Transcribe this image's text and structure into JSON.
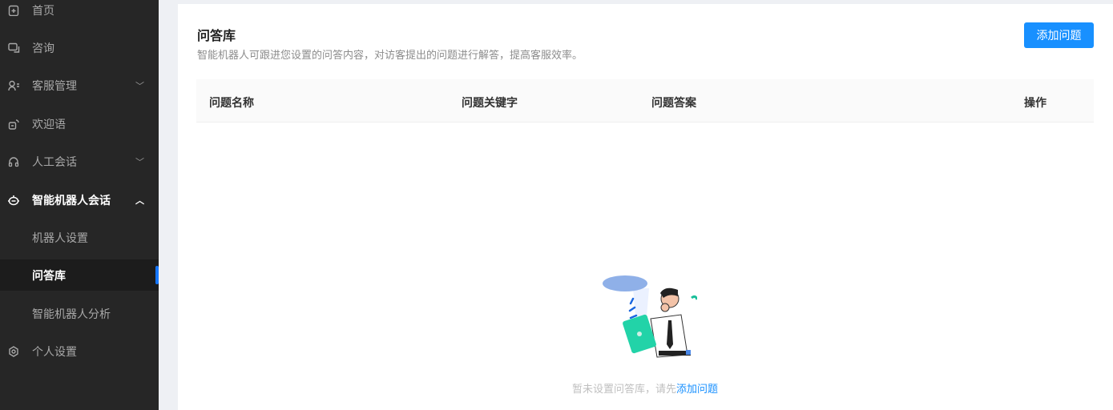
{
  "sidebar": {
    "items": [
      {
        "label": "首页",
        "icon": "clipboard-icon"
      },
      {
        "label": "咨询",
        "icon": "chat-icon"
      },
      {
        "label": "客服管理",
        "icon": "user-list-icon"
      },
      {
        "label": "欢迎语",
        "icon": "welcome-icon"
      },
      {
        "label": "人工会话",
        "icon": "headset-icon"
      },
      {
        "label": "智能机器人会话",
        "icon": "robot-icon"
      },
      {
        "label": "个人设置",
        "icon": "gear-icon"
      }
    ],
    "sub_items": [
      {
        "label": "机器人设置"
      },
      {
        "label": "问答库"
      },
      {
        "label": "智能机器人分析"
      }
    ]
  },
  "main": {
    "title": "问答库",
    "description": "智能机器人可跟进您设置的问答内容，对访客提出的问题进行解答，提高客服效率。",
    "add_button": "添加问题",
    "columns": [
      "问题名称",
      "问题关键字",
      "问题答案",
      "操作"
    ],
    "empty_text": "暂未设置问答库，请先",
    "empty_link": "添加问题"
  },
  "colors": {
    "accent": "#1890ff",
    "sidebar": "#262626"
  }
}
